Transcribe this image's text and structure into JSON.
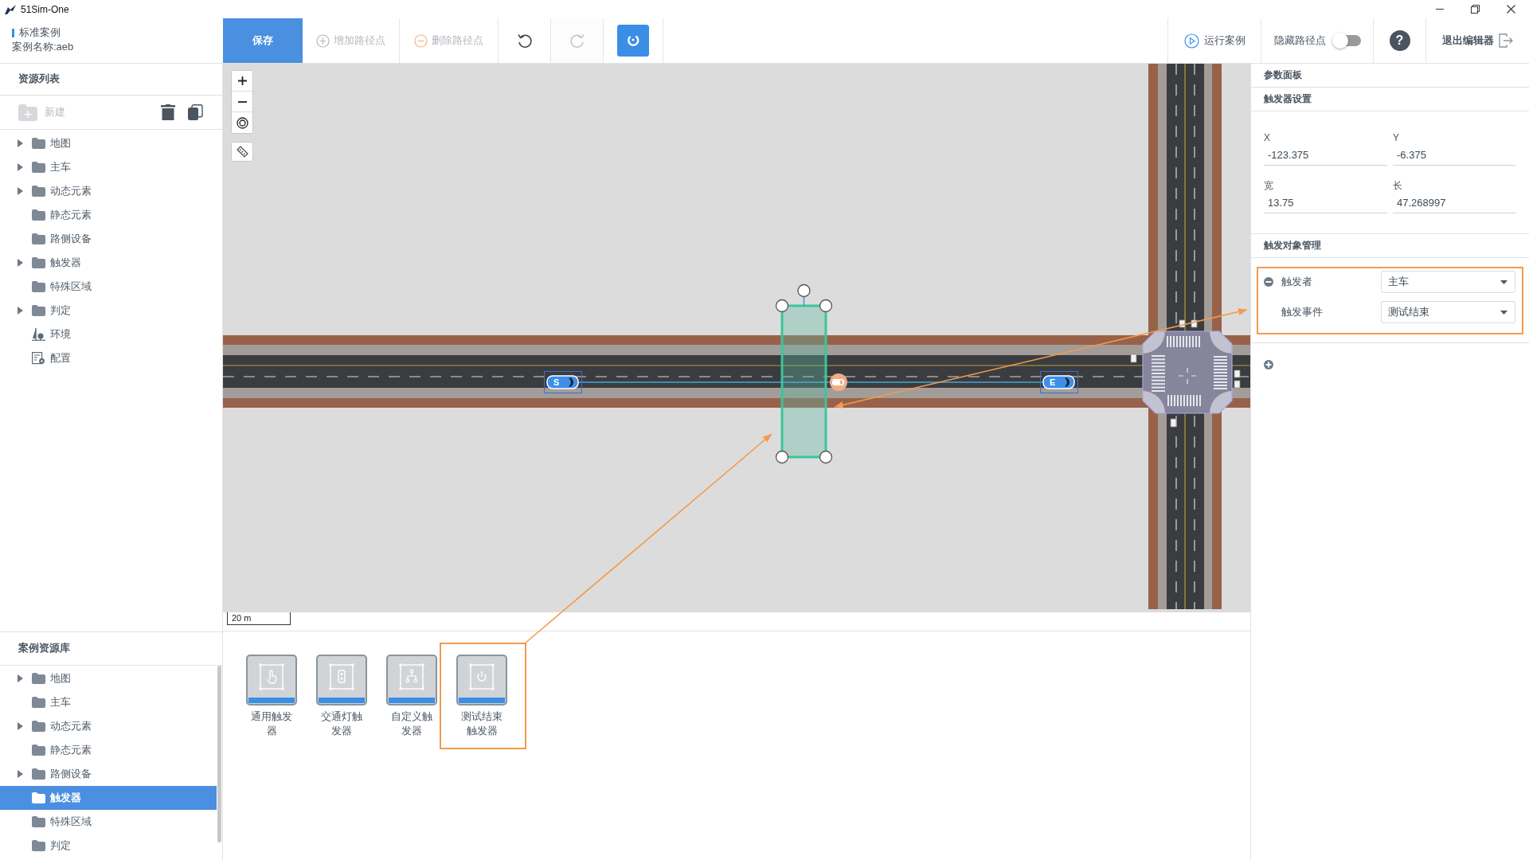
{
  "window": {
    "title": "51Sim-One"
  },
  "case_info": {
    "category": "标准案例",
    "name": "案例名称:aeb"
  },
  "toolbar": [
    {
      "kind": "save",
      "label": "保存",
      "disabled": false
    },
    {
      "kind": "add",
      "label": "增加路径点",
      "disabled": true
    },
    {
      "kind": "remove",
      "label": "删除路径点",
      "disabled": true
    },
    {
      "kind": "undo",
      "disabled": false
    },
    {
      "kind": "redo",
      "disabled": true
    },
    {
      "kind": "snap",
      "disabled": false,
      "on": true
    }
  ],
  "actions": {
    "run": {
      "label": "运行案例"
    },
    "hide_waypoints": {
      "label": "隐藏路径点",
      "on": false
    },
    "help": {
      "label": "?"
    },
    "exit": {
      "label": "退出编辑器"
    }
  },
  "resource_list": {
    "title": "资源列表",
    "new_button": {
      "label": "新建",
      "disabled": true
    },
    "items": [
      {
        "kind": "folder",
        "label": "地图",
        "expandable": true
      },
      {
        "kind": "folder",
        "label": "主车",
        "expandable": true
      },
      {
        "kind": "folder",
        "label": "动态元素",
        "expandable": true
      },
      {
        "kind": "folder",
        "label": "静态元素",
        "expandable": false
      },
      {
        "kind": "folder",
        "label": "路侧设备",
        "expandable": false
      },
      {
        "kind": "folder",
        "label": "触发器",
        "expandable": true
      },
      {
        "kind": "folder",
        "label": "特殊区域",
        "expandable": false
      },
      {
        "kind": "folder",
        "label": "判定",
        "expandable": true
      },
      {
        "kind": "environment",
        "label": "环境",
        "expandable": false
      },
      {
        "kind": "config",
        "label": "配置",
        "expandable": false
      }
    ]
  },
  "map": {
    "vehicles": [
      {
        "kind": "start",
        "label": "S"
      },
      {
        "kind": "end",
        "label": "E"
      }
    ],
    "scale": "20 m"
  },
  "case_library": {
    "title": "案例资源库",
    "items": [
      {
        "label": "地图",
        "expandable": true,
        "selected": false
      },
      {
        "label": "主车",
        "expandable": false,
        "selected": false
      },
      {
        "label": "动态元素",
        "expandable": true,
        "selected": false
      },
      {
        "label": "静态元素",
        "expandable": false,
        "selected": false
      },
      {
        "label": "路侧设备",
        "expandable": true,
        "selected": false
      },
      {
        "label": "触发器",
        "expandable": false,
        "selected": true
      },
      {
        "label": "特殊区域",
        "expandable": false,
        "selected": false
      },
      {
        "label": "判定",
        "expandable": false,
        "selected": false
      }
    ]
  },
  "trigger_types": [
    {
      "kind": "general",
      "label": "通用触发器",
      "highlighted": false
    },
    {
      "kind": "traffic_light",
      "label": "交通灯触发器",
      "highlighted": false
    },
    {
      "kind": "custom",
      "label": "自定义触发器",
      "highlighted": false
    },
    {
      "kind": "test_end",
      "label": "测试结束触发器",
      "highlighted": true
    }
  ],
  "param_panel": {
    "title": "参数面板",
    "section": "触发器设置",
    "fields": [
      {
        "label": "X",
        "value": "-123.375"
      },
      {
        "label": "Y",
        "value": "-6.375"
      },
      {
        "label": "宽",
        "value": "13.75"
      },
      {
        "label": "长",
        "value": "47.268997"
      }
    ],
    "targets_title": "触发对象管理",
    "target_group": {
      "highlighted": true,
      "rows": [
        {
          "label": "触发者",
          "value": "主车",
          "removable": true
        },
        {
          "label": "触发事件",
          "value": "测试结束",
          "removable": false
        }
      ]
    }
  }
}
